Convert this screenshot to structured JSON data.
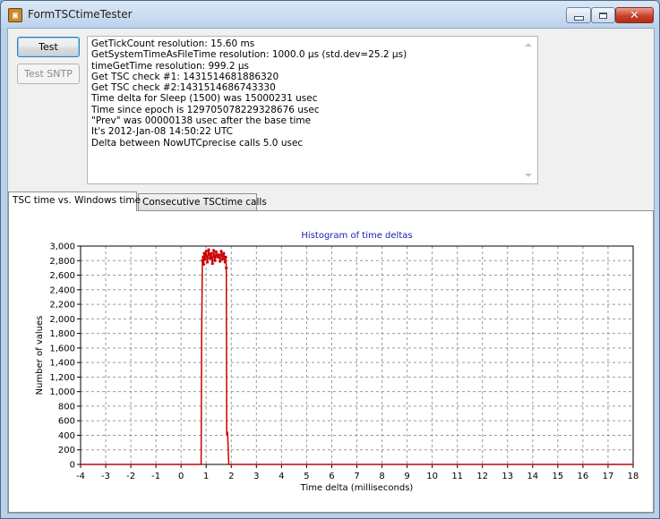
{
  "window": {
    "title": "FormTSCtimeTester"
  },
  "buttons": {
    "test": "Test",
    "test_sntp": "Test SNTP"
  },
  "memo": {
    "lines": [
      "GetTickCount resolution: 15.60 ms",
      "GetSystemTimeAsFileTime resolution: 1000.0 µs  (std.dev=25.2 µs)",
      "timeGetTime resolution: 999.2 µs",
      "Get TSC check #1: 1431514681886320",
      "Get TSC check #2:1431514686743330",
      "Time delta for Sleep (1500) was 15000231 usec",
      "Time since epoch is 129705078229328676 usec",
      "\"Prev\" was 00000138 usec after the base time",
      "It's 2012-Jan-08 14:50:22 UTC",
      "Delta between NowUTCprecise calls 5.0 usec"
    ]
  },
  "tabs": [
    {
      "label": "TSC time vs. Windows time",
      "active": true
    },
    {
      "label": "Consecutive TSCtime calls",
      "active": false
    }
  ],
  "chart_data": {
    "type": "line",
    "title": "Histogram of time deltas",
    "xlabel": "Time delta (milliseconds)",
    "ylabel": "Number of values",
    "xlim": [
      -4,
      18
    ],
    "ylim": [
      0,
      3000
    ],
    "xticks": [
      -4,
      -3,
      -2,
      -1,
      0,
      1,
      2,
      3,
      4,
      5,
      6,
      7,
      8,
      9,
      10,
      11,
      12,
      13,
      14,
      15,
      16,
      17,
      18
    ],
    "yticks": [
      0,
      200,
      400,
      600,
      800,
      1000,
      1200,
      1400,
      1600,
      1800,
      2000,
      2200,
      2400,
      2600,
      2800,
      3000
    ],
    "ytick_labels": [
      "0",
      "200",
      "400",
      "600",
      "800",
      "1,000",
      "1,200",
      "1,400",
      "1,600",
      "1,800",
      "2,000",
      "2,200",
      "2,400",
      "2,600",
      "2,800",
      "3,000"
    ],
    "grid": true,
    "series": [
      {
        "color": "#cc0000",
        "x": [
          -4,
          0.8,
          0.82,
          0.85,
          0.88,
          0.9,
          0.92,
          0.95,
          1.0,
          1.05,
          1.1,
          1.15,
          1.2,
          1.25,
          1.3,
          1.35,
          1.4,
          1.45,
          1.5,
          1.55,
          1.6,
          1.65,
          1.7,
          1.75,
          1.78,
          1.8,
          1.82,
          1.85,
          1.9,
          18
        ],
        "y": [
          0,
          0,
          1800,
          2800,
          2850,
          2750,
          2900,
          2820,
          2930,
          2780,
          2950,
          2830,
          2900,
          2760,
          2940,
          2800,
          2920,
          2850,
          2880,
          2790,
          2930,
          2820,
          2900,
          2780,
          2850,
          2700,
          400,
          450,
          0,
          0
        ]
      }
    ]
  }
}
